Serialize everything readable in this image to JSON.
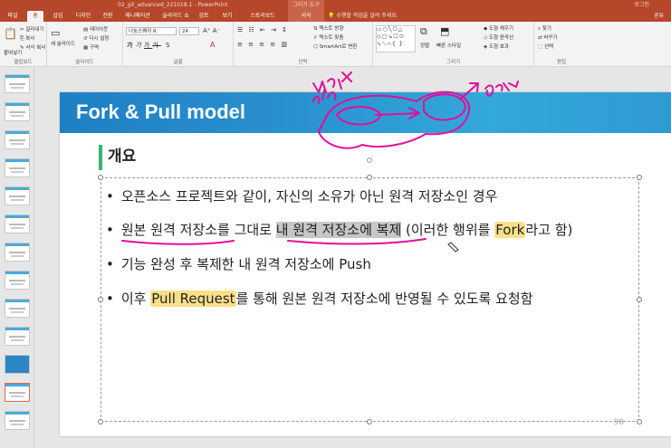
{
  "titlebar": {
    "document": "02_git_advanced_221018.1 - PowerPoint",
    "context_tab_group": "그리기 도구",
    "user": "로그인"
  },
  "tabs": {
    "items": [
      "파일",
      "홈",
      "삽입",
      "디자인",
      "전환",
      "애니메이션",
      "슬라이드 쇼",
      "검토",
      "보기",
      "스토리보드",
      "서식"
    ],
    "active": "홈",
    "tell_me": "수행할 작업을 알려 주세요.",
    "share": "공유"
  },
  "ribbon": {
    "clipboard": {
      "label": "클립보드",
      "paste": "붙여넣기",
      "cut": "잘라내기",
      "copy": "복사",
      "format_painter": "서식 복사"
    },
    "slides": {
      "label": "슬라이드",
      "new_slide": "새 슬라이드",
      "layout": "레이아웃",
      "reset": "다시 설정",
      "section": "구역"
    },
    "font": {
      "label": "글꼴",
      "name": "나눔스퀘어 R",
      "size": "24"
    },
    "paragraph": {
      "label": "단락",
      "direction": "텍스트 방향",
      "align": "텍스트 맞춤",
      "smartart": "SmartArt로 변환"
    },
    "drawing": {
      "label": "그리기",
      "arrange": "정렬",
      "quick_styles": "빠른 스타일",
      "fill": "도형 채우기",
      "outline": "도형 윤곽선",
      "effects": "도형 효과"
    },
    "editing": {
      "label": "편집",
      "find": "찾기",
      "replace": "바꾸기",
      "select": "선택"
    }
  },
  "slide": {
    "title": "Fork & Pull model",
    "section": "개요",
    "bullets": [
      {
        "text": "오픈소스 프로젝트와 같이, 자신의 소유가 아닌 원격 저장소인 경우"
      },
      {
        "pre": "원본 원격 저장소를 그대로 ",
        "gray": "내 원격 저장소에 복제",
        "mid": " (이러한 행위를 ",
        "hl": "Fork",
        "post": "라고 함)"
      },
      {
        "text": "기능 완성 후 복제한 내 원격 저장소에 Push"
      },
      {
        "pre": "이후 ",
        "hl": "Pull Request",
        "post": "를 통해 원본 원격 저장소에 반영될 수 있도록 요청함"
      }
    ],
    "page_number": "98"
  },
  "colors": {
    "accent": "#b7472a",
    "banner": "#2a92d0",
    "highlight": "#ffe08a",
    "ink": "#e0109a",
    "section_bar": "#3cb371"
  }
}
